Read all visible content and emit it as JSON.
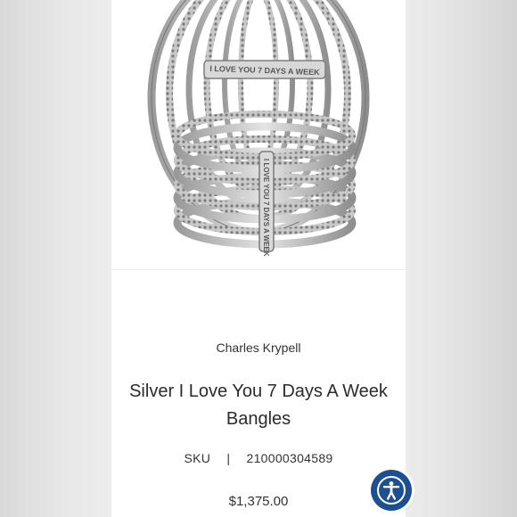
{
  "product": {
    "brand": "Charles Krypell",
    "title": "Silver I Love You 7 Days A Week Bangles",
    "sku_label": "SKU",
    "sku_separator": "|",
    "sku_value": "210000304589",
    "price": "$1,375.00",
    "engraving": "I LOVE YOU 7 DAYS A WEEK"
  },
  "accessibility": {
    "icon": "accessibility-icon",
    "color": "#1d4f91"
  }
}
